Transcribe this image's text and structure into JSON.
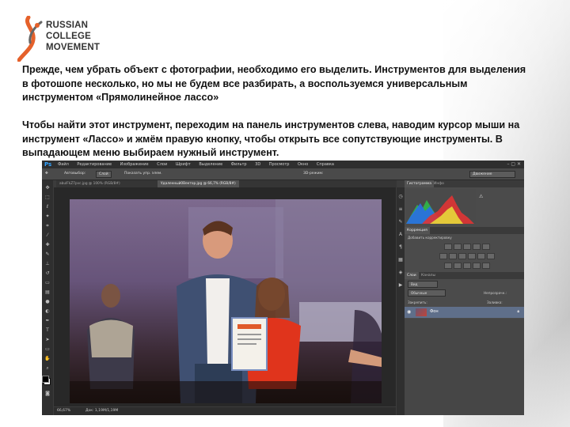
{
  "logo": {
    "lines": [
      "RUSSIAN",
      "COLLEGE",
      "MOVEMENT"
    ]
  },
  "text": {
    "paragraph1": "Прежде, чем убрать объект с фотографии, необходимо его выделить. Инструментов для выделения в фотошопе несколько, но мы не будем все разбирать, а воспользуемся универсальным инструментом «Прямолинейное лассо»",
    "paragraph2": "Чтобы найти этот инструмент, переходим на панель инструментов слева, наводим курсор мыши на инструмент «Лассо» и жмём правую кнопку, чтобы открыть все сопутствующие инструменты. В выпадающем меню выбираем нужный инструмент."
  },
  "photoshop": {
    "app_icon": "Ps",
    "menu": [
      "Файл",
      "Редактирование",
      "Изображение",
      "Слои",
      "Шрифт",
      "Выделение",
      "Фильтр",
      "3D",
      "Просмотр",
      "Окно",
      "Справка"
    ],
    "window_controls": "–  ▢  ✕",
    "options": {
      "autoselect_label": "Автовыбор:",
      "autoselect_value": "Слой",
      "transform_label": "Показать упр. элем.",
      "mode_3d": "3D-режим:",
      "workspace": "Движение"
    },
    "tabs": [
      "abulFkZ7pvc.jpg @ 100% (RGB/8#)",
      "Удаленный0Вектор.jpg @ 66,7% (RGB/8#)"
    ],
    "active_tab": 1,
    "status": {
      "zoom": "66,67%",
      "doc": "Док: 1,19M/1,19M"
    },
    "panels": {
      "histogram_tabs": [
        "Гистограмма",
        "Инфо"
      ],
      "adjust_tabs": [
        "Коррекция"
      ],
      "adjust_title": "Добавить корректировку",
      "layers_tabs": [
        "Слои",
        "Каналы"
      ],
      "kind": "Вид",
      "blend": "Обычные",
      "opacity_label": "Непрозрачн.:",
      "lock_label": "Закрепить:",
      "fill_label": "Заливка:",
      "layer_name": "Фон"
    }
  },
  "icons": [
    "logo-swirl",
    "photoshop-icon",
    "move-tool-icon",
    "marquee-tool-icon",
    "lasso-tool-icon",
    "magic-wand-icon",
    "crop-icon",
    "eyedropper-icon",
    "brush-icon",
    "eraser-icon",
    "gradient-icon",
    "pen-icon",
    "type-icon",
    "hand-icon",
    "zoom-icon",
    "eye-icon",
    "lock-icon"
  ],
  "colors": {
    "ps_dark": "#3c3c3c",
    "ps_accent": "#33a3ff",
    "layer_selected": "#5f6f8a",
    "logo_orange": "#e5612b"
  }
}
